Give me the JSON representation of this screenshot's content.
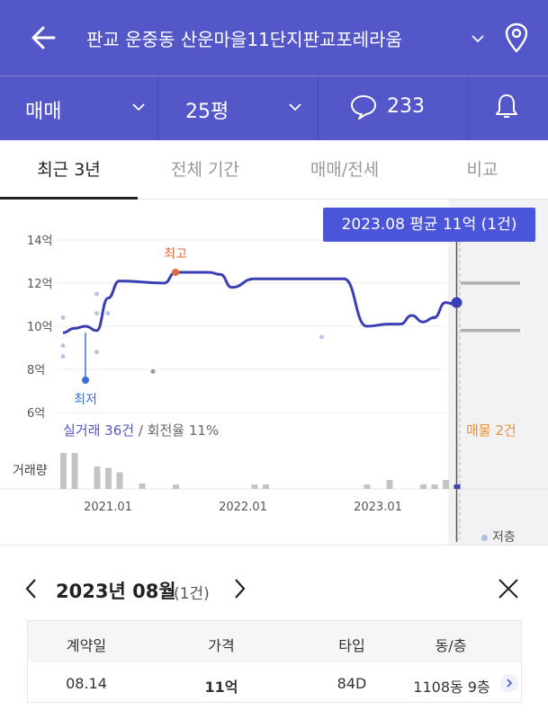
{
  "header": {
    "title": "판교 운중동 산운마을11단지판교포레라움",
    "trade_type": "매매",
    "size": "25평",
    "comments_count": "233"
  },
  "tabs": [
    "최근 3년",
    "전체 기간",
    "매매/전세",
    "비교"
  ],
  "tooltip": "2023.08 평균 11억 (1건)",
  "stats": {
    "real_trades": "실거래 36건",
    "turnover": " / 회전율 11%",
    "listings": "매물 2건"
  },
  "volume_label": "거래량",
  "legend": "저층",
  "detail": {
    "month": "2023년 08월",
    "count": "(1건)",
    "columns": [
      "계약일",
      "가격",
      "타입",
      "동/층"
    ],
    "row": {
      "date": "08.14",
      "price": "11억",
      "type": "84D",
      "dong_floor": "1108동 9층"
    }
  },
  "chart_data": {
    "type": "line",
    "ylabels": [
      "14억",
      "12억",
      "10억",
      "8억",
      "6억"
    ],
    "ylim": [
      6,
      14
    ],
    "xlabels": [
      "2021.01",
      "2022.01",
      "2023.01"
    ],
    "high_label": "최고",
    "low_label": "최저",
    "high_value": 12.5,
    "low_value": 7.5,
    "series": [
      {
        "x": [
          "2020.09",
          "2020.10",
          "2020.11",
          "2020.12",
          "2021.01",
          "2021.02",
          "2021.06",
          "2021.07",
          "2021.09",
          "2021.10",
          "2021.11",
          "2021.12",
          "2022.02",
          "2022.09",
          "2022.10",
          "2022.12",
          "2023.02",
          "2023.03",
          "2023.04",
          "2023.05",
          "2023.06",
          "2023.07",
          "2023.08"
        ],
        "values": [
          9.7,
          9.9,
          10.0,
          9.8,
          11.3,
          12.1,
          12.0,
          12.5,
          12.5,
          12.5,
          12.4,
          11.8,
          12.2,
          12.2,
          12.2,
          10.0,
          10.1,
          10.1,
          10.5,
          10.2,
          10.4,
          11.1,
          11.0
        ]
      }
    ],
    "listing_prices": [
      12.0,
      9.8
    ],
    "low_floor_points": [
      {
        "x": "2020.09",
        "y": 10.4
      },
      {
        "x": "2020.09",
        "y": 9.1
      },
      {
        "x": "2020.09",
        "y": 8.6
      },
      {
        "x": "2020.12",
        "y": 11.5
      },
      {
        "x": "2020.12",
        "y": 10.6
      },
      {
        "x": "2020.12",
        "y": 8.8
      },
      {
        "x": "2021.01",
        "y": 10.6
      },
      {
        "x": "2021.05",
        "y": 7.9
      },
      {
        "x": "2022.08",
        "y": 9.5
      },
      {
        "x": "2023.06",
        "y": 10.4
      }
    ],
    "volume": [
      {
        "x": "2020.09",
        "v": 8
      },
      {
        "x": "2020.10",
        "v": 8
      },
      {
        "x": "2020.12",
        "v": 5
      },
      {
        "x": "2021.01",
        "v": 4.7
      },
      {
        "x": "2021.02",
        "v": 3.7
      },
      {
        "x": "2021.04",
        "v": 1.2
      },
      {
        "x": "2021.07",
        "v": 1
      },
      {
        "x": "2022.02",
        "v": 1
      },
      {
        "x": "2022.03",
        "v": 1
      },
      {
        "x": "2022.12",
        "v": 1
      },
      {
        "x": "2023.02",
        "v": 2
      },
      {
        "x": "2023.05",
        "v": 1
      },
      {
        "x": "2023.06",
        "v": 1
      },
      {
        "x": "2023.07",
        "v": 2
      },
      {
        "x": "2023.08",
        "v": 1
      }
    ]
  }
}
